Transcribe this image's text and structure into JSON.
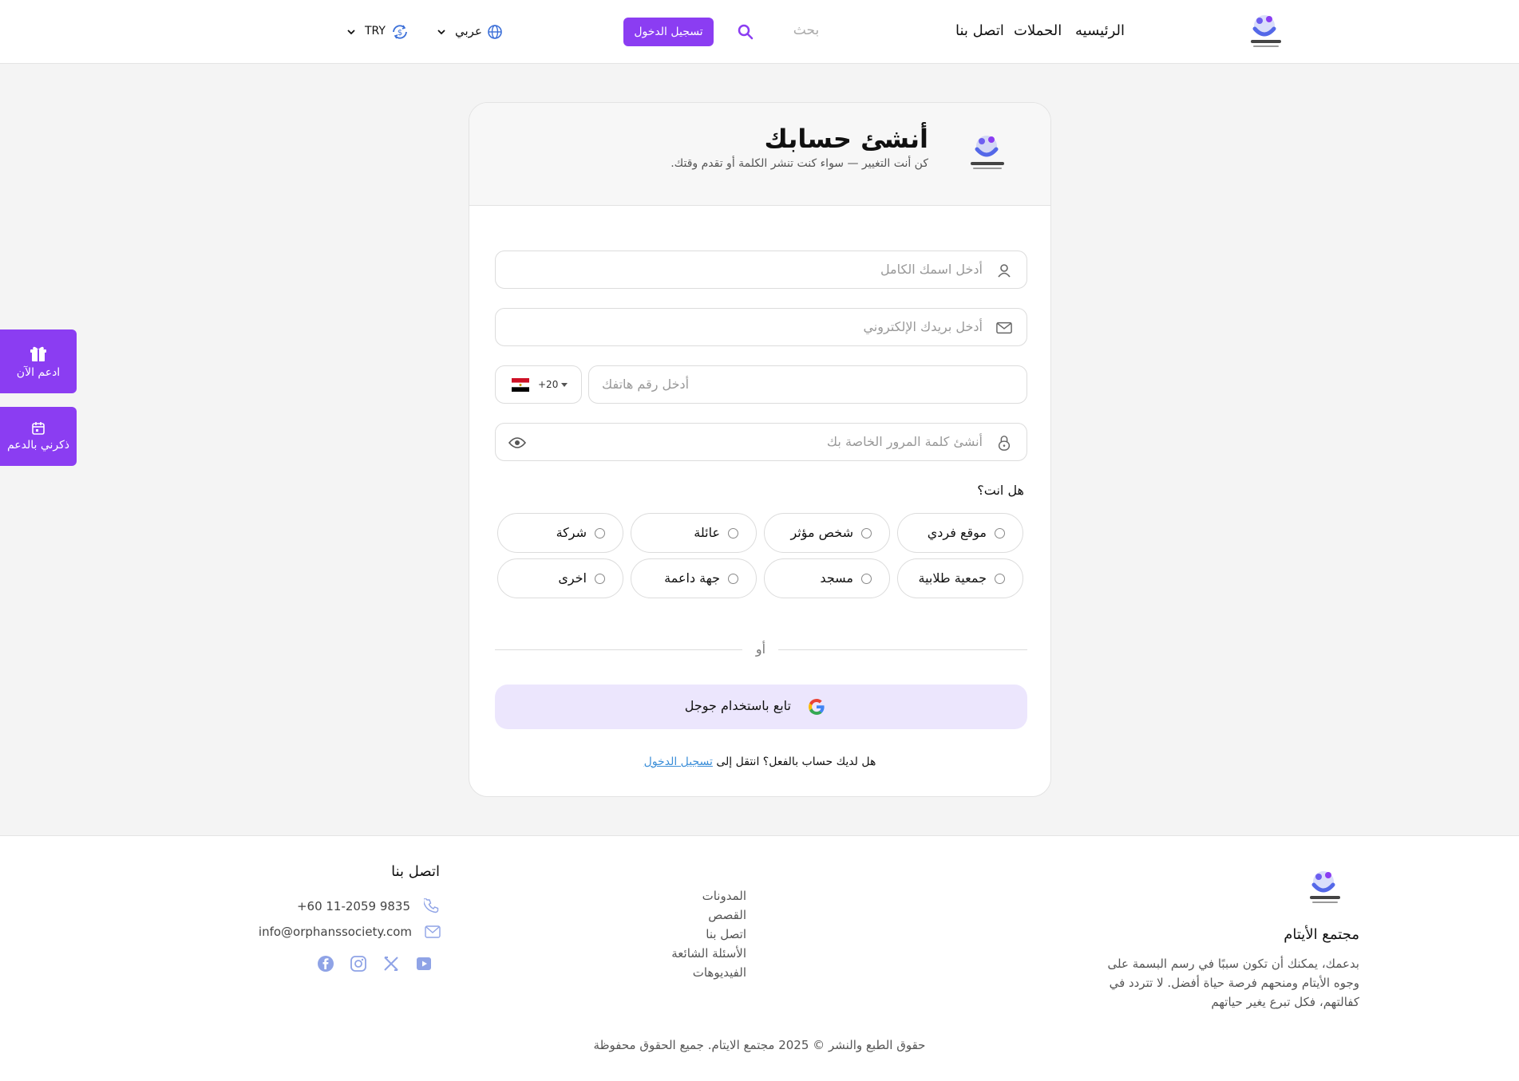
{
  "header": {
    "nav": [
      "الرئيسيه",
      "الحملات",
      "اتصل بنا"
    ],
    "search_placeholder": "بحث",
    "login_label": "تسجيل الدخول",
    "language_label": "عربي",
    "currency_label": "TRY"
  },
  "side_buttons": {
    "support_now": "ادعم الآن",
    "remind_me": "ذكرني بالدعم"
  },
  "signup": {
    "title": "أنشئ حسابك",
    "subtitle": "كن أنت التغيير — سواء كنت تنشر الكلمة أو تقدم وقتك.",
    "fullname_placeholder": "أدخل اسمك الكامل",
    "email_placeholder": "أدخل بريدك الإلكتروني",
    "phone_code": "+20",
    "phone_placeholder": "أدخل رقم هاتفك",
    "password_placeholder": "أنشئ كلمة المرور الخاصة بك",
    "question": "هل انت؟",
    "options": [
      "موقع فردي",
      "شخص مؤثر",
      "عائلة",
      "شركة",
      "جمعية طلابية",
      "مسجد",
      "جهة داعمة",
      "اخرى"
    ],
    "or_label": "أو",
    "google_label": "تابع باستخدام جوجل",
    "have_account_text": "هل لديك حساب بالفعل؟ انتقل إلى",
    "login_link": "تسجيل الدخول"
  },
  "footer": {
    "brand": "مجتمع الأيتام",
    "description": "بدعمك، يمكنك أن تكون سببًا في رسم البسمة على وجوه الأيتام ومنحهم فرصة حياة أفضل. لا تتردد في كفالتهم، فكل تبرع يغير حياتهم",
    "links": [
      "المدونات",
      "القصص",
      "اتصل بنا",
      "الأسئلة الشائعة",
      "الفيديوهات"
    ],
    "contact_title": "اتصل بنا",
    "phone": "+60 11-2059 9835",
    "email": "info@orphanssociety.com",
    "copyright": "حقوق الطبع والنشر © 2025 مجتمع الايتام. جميع الحقوق محفوظة"
  },
  "colors": {
    "accent": "#8b3df2",
    "google_button_bg": "#ece6fd",
    "link": "#3b8ed8"
  },
  "icons": [
    "logo-icon",
    "search-icon",
    "globe-icon",
    "currency-icon",
    "chevron-down-icon",
    "gift-icon",
    "calendar-icon",
    "user-icon",
    "mail-icon",
    "lock-icon",
    "eye-icon",
    "egypt-flag-icon",
    "google-icon",
    "phone-icon",
    "facebook-icon",
    "instagram-icon",
    "x-icon",
    "youtube-icon"
  ]
}
